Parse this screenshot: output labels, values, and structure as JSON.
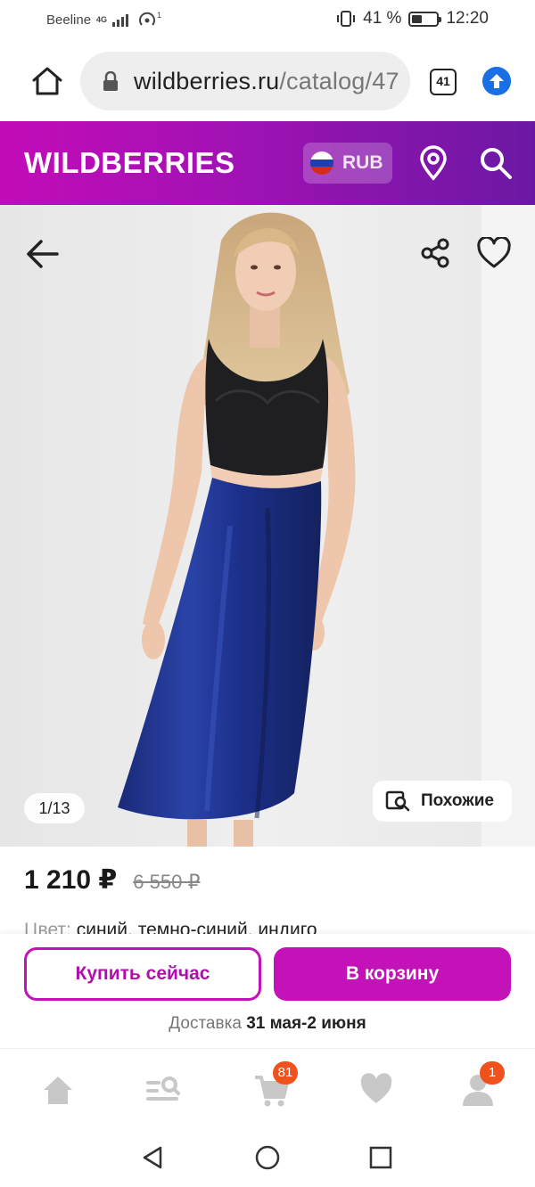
{
  "status_bar": {
    "carrier": "Beeline",
    "network": "4G",
    "battery_percent": "41 %",
    "battery_level": 0.41,
    "time": "12:20"
  },
  "browser": {
    "url_domain": "wildberries.ru",
    "url_path": "/catalog/47",
    "tab_count": "41"
  },
  "header": {
    "logo": "WILDBERRIES",
    "currency": "RUB"
  },
  "product": {
    "image_counter": "1/13",
    "similar_label": "Похожие",
    "price": "1 210 ₽",
    "old_price": "6 550 ₽",
    "color_label": "Цвет:",
    "color_values": "синий, темно-синий, индиго"
  },
  "actions": {
    "buy_now": "Купить сейчас",
    "add_to_cart": "В корзину",
    "delivery_label": "Доставка",
    "delivery_dates": "31 мая-2 июня"
  },
  "bottom_nav": {
    "cart_badge": "81",
    "profile_badge": "1"
  },
  "colors": {
    "brand_magenta": "#c312b8",
    "brand_purple": "#6a18a3",
    "badge_orange": "#f0521e",
    "skirt_blue": "#1c2f8a"
  }
}
